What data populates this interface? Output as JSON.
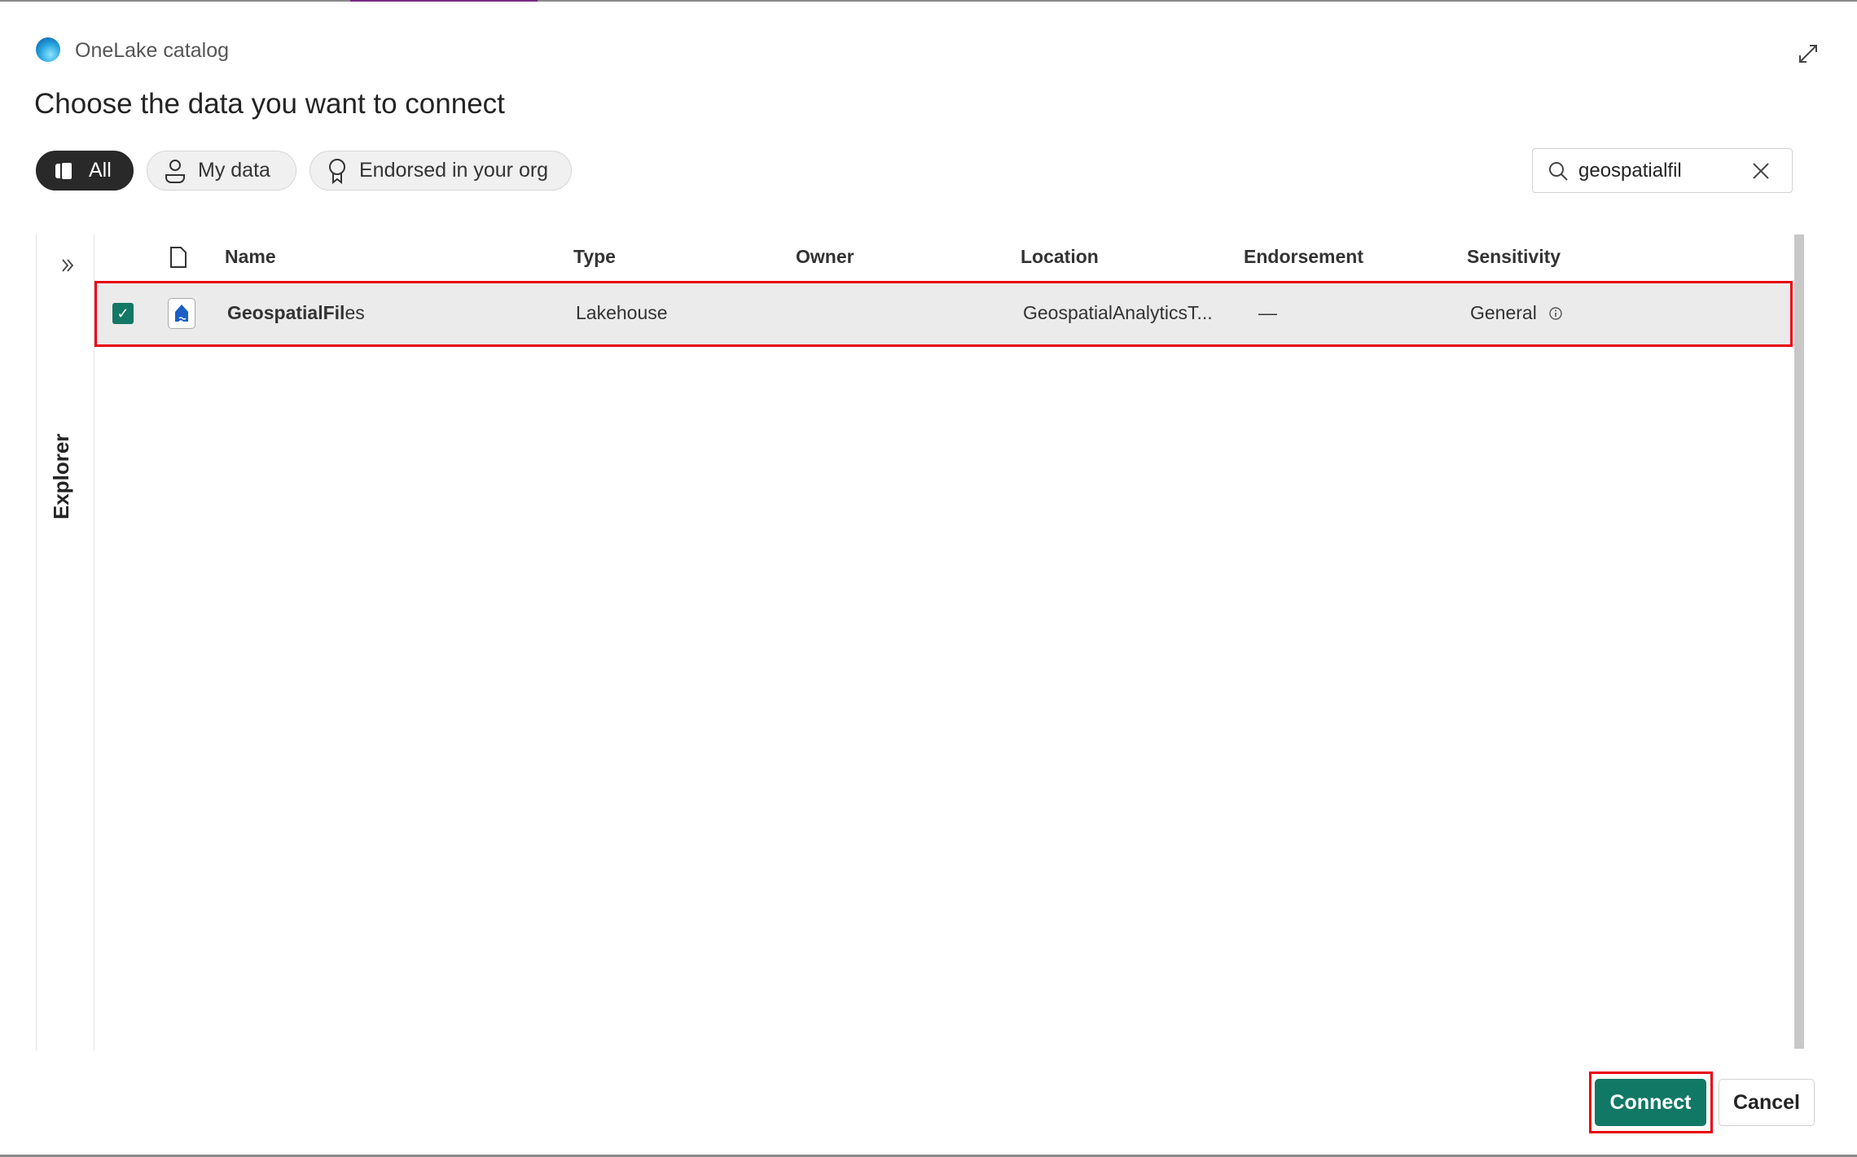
{
  "app": {
    "title": "OneLake catalog",
    "heading": "Choose the data you want to connect"
  },
  "filters": [
    {
      "label": "All",
      "icon": "cube-stack-icon",
      "active": true
    },
    {
      "label": "My data",
      "icon": "person-icon",
      "active": false
    },
    {
      "label": "Endorsed in your org",
      "icon": "ribbon-icon",
      "active": false
    }
  ],
  "search": {
    "value": "geospatialfil"
  },
  "explorer": {
    "label": "Explorer"
  },
  "table": {
    "columns": [
      "Name",
      "Type",
      "Owner",
      "Location",
      "Endorsement",
      "Sensitivity"
    ],
    "rows": [
      {
        "selected": true,
        "name_match": "GeospatialFil",
        "name_rest": "es",
        "type": "Lakehouse",
        "owner": "",
        "location": "GeospatialAnalyticsT...",
        "endorsement": "—",
        "sensitivity": "General"
      }
    ]
  },
  "actions": {
    "connect": "Connect",
    "cancel": "Cancel"
  },
  "colors": {
    "accent": "#117865",
    "highlight": "#e8000b"
  }
}
